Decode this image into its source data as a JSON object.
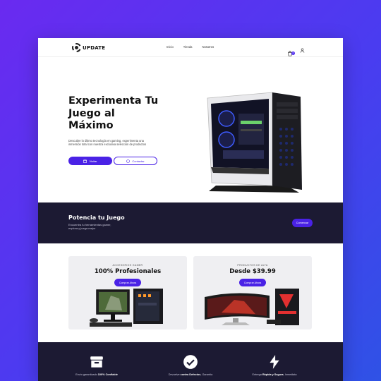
{
  "brand": {
    "logo_text": "UPDATE"
  },
  "nav": {
    "items": [
      "Inicio",
      "Tienda",
      "Nosotros"
    ]
  },
  "header": {
    "cart_count": "0"
  },
  "hero": {
    "title": "Experimenta Tu Juego al Máximo",
    "description": "Descubre lo último tecnología en gaming, experimenta una inmersión total con nuestra exclusiva selección de productos",
    "primary_button": "Visitar",
    "secondary_button": "Contactar"
  },
  "band": {
    "title": "Potencia tu Juego",
    "subtitle": "Encuentra tu herramientas gamer, explora y juega mejor",
    "button": "Comenzar"
  },
  "cards": [
    {
      "eyebrow": "ACCESORIOS GAMER",
      "title": "100% Profesionales",
      "button": "Comprar Ahora"
    },
    {
      "eyebrow": "PRODUCTOS DE ALTA",
      "title": "Desde $39.99",
      "button": "Comprar Ahora"
    }
  ],
  "features": [
    {
      "icon": "box-icon",
      "prefix": "Envío garantizado ",
      "bold": "100% Confiable"
    },
    {
      "icon": "check-circle-icon",
      "prefix": "Devuelve ",
      "bold": "contra Defectos",
      "suffix": ", Garantía"
    },
    {
      "icon": "lightning-icon",
      "prefix": "Entrega ",
      "bold": "Rápida y Segura",
      "suffix": ", Inmediata"
    }
  ],
  "colors": {
    "accent": "#4a22e6",
    "dark": "#1c1a33",
    "bg_gradient_start": "#6a2af0",
    "bg_gradient_end": "#2f52e6"
  }
}
